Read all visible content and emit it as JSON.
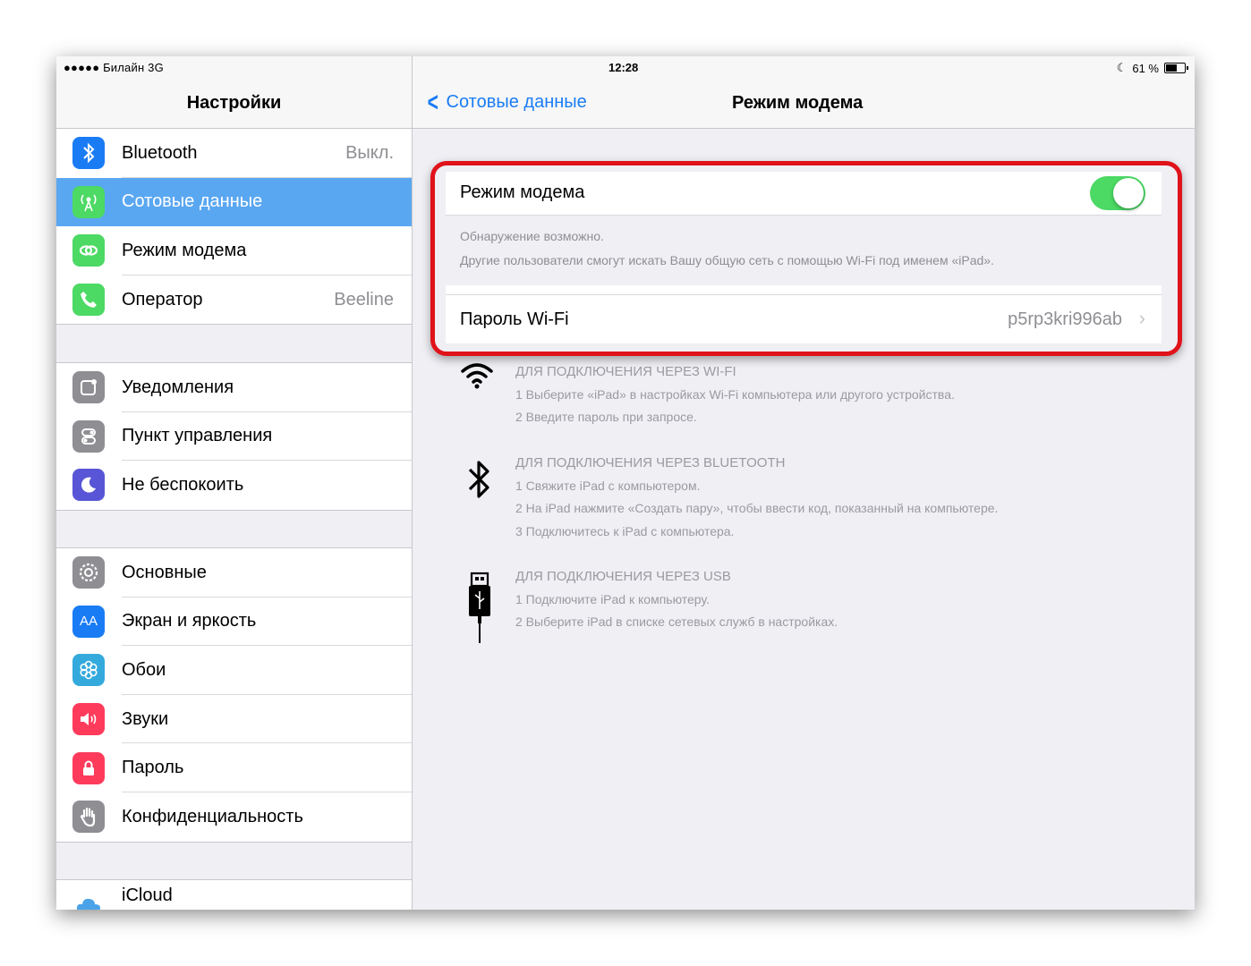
{
  "status": {
    "carrier": "●●●●● Билайн  3G",
    "time": "12:28",
    "battery": "61 %",
    "battery_level": 0.61
  },
  "sidebar": {
    "title": "Настройки",
    "group1": [
      {
        "label": "Bluetooth",
        "value": "Выкл.",
        "icon": "bluetooth-icon",
        "color": "#1a7cf5"
      },
      {
        "label": "Сотовые данные",
        "value": "",
        "icon": "cellular-icon",
        "color": "#4cd964",
        "selected": true
      },
      {
        "label": "Режим модема",
        "value": "",
        "icon": "hotspot-icon",
        "color": "#4cd964"
      },
      {
        "label": "Оператор",
        "value": "Beeline",
        "icon": "phone-icon",
        "color": "#4cd964"
      }
    ],
    "group2": [
      {
        "label": "Уведомления",
        "icon": "notifications-icon",
        "color": "#8e8e93"
      },
      {
        "label": "Пункт управления",
        "icon": "control-center-icon",
        "color": "#8e8e93"
      },
      {
        "label": "Не беспокоить",
        "icon": "moon-icon",
        "color": "#5856d6"
      }
    ],
    "group3": [
      {
        "label": "Основные",
        "icon": "gear-icon",
        "color": "#8e8e93"
      },
      {
        "label": "Экран и яркость",
        "icon": "display-icon",
        "color": "#1a7cf5"
      },
      {
        "label": "Обои",
        "icon": "wallpaper-icon",
        "color": "#34aadc"
      },
      {
        "label": "Звуки",
        "icon": "sounds-icon",
        "color": "#ff3b5c"
      },
      {
        "label": "Пароль",
        "icon": "lock-icon",
        "color": "#ff3b5c"
      },
      {
        "label": "Конфиденциальность",
        "icon": "hand-icon",
        "color": "#8e8e93"
      }
    ],
    "group4": [
      {
        "label": "iCloud",
        "icon": "cloud-icon",
        "color": "#ffffff"
      }
    ]
  },
  "detail": {
    "back_label": "Сотовые данные",
    "title": "Режим модема",
    "toggle_label": "Режим модема",
    "toggle_on": true,
    "note_line1": "Обнаружение возможно.",
    "note_line2": "Другие пользователи смогут искать Вашу общую сеть с помощью Wi-Fi под именем «iPad».",
    "wifi_password_label": "Пароль Wi-Fi",
    "wifi_password_value": "p5rp3kri996ab"
  },
  "instructions": [
    {
      "icon": "wifi-icon",
      "heading": "ДЛЯ ПОДКЛЮЧЕНИЯ ЧЕРЕЗ WI-FI",
      "steps": [
        "1 Выберите «iPad» в настройках Wi-Fi компьютера или другого устройства.",
        "2 Введите пароль при запросе."
      ]
    },
    {
      "icon": "bluetooth-icon",
      "heading": "ДЛЯ ПОДКЛЮЧЕНИЯ ЧЕРЕЗ BLUETOOTH",
      "steps": [
        "1 Свяжите iPad с компьютером.",
        "2 На iPad нажмите «Создать пару», чтобы ввести код, показанный на компьютере.",
        "3 Подключитесь к iPad с компьютера."
      ]
    },
    {
      "icon": "usb-icon",
      "heading": "ДЛЯ ПОДКЛЮЧЕНИЯ ЧЕРЕЗ USB",
      "steps": [
        "1 Подключите iPad к компьютеру.",
        "2 Выберите iPad в списке сетевых служб в настройках."
      ]
    }
  ]
}
